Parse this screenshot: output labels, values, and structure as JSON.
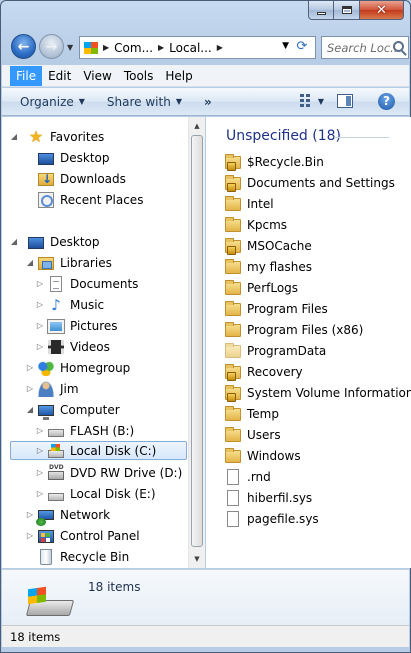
{
  "window": {
    "caption_buttons": [
      "minimize",
      "maximize",
      "close"
    ]
  },
  "nav": {
    "breadcrumbs": [
      "Com...",
      "Local..."
    ],
    "search_placeholder": "Search Loc..."
  },
  "menu": [
    "File",
    "Edit",
    "View",
    "Tools",
    "Help"
  ],
  "toolbar": {
    "organize": "Organize",
    "share_with": "Share with",
    "more": "»"
  },
  "tree": [
    {
      "label": "Favorites",
      "icon": "star-icon"
    },
    {
      "label": "Desktop",
      "icon": "desktop-icon"
    },
    {
      "label": "Downloads",
      "icon": "downloads-folder-icon"
    },
    {
      "label": "Recent Places",
      "icon": "recent-places-icon"
    },
    {
      "label": "Desktop",
      "icon": "desktop-icon"
    },
    {
      "label": "Libraries",
      "icon": "libraries-icon"
    },
    {
      "label": "Documents",
      "icon": "document-icon"
    },
    {
      "label": "Music",
      "icon": "music-icon"
    },
    {
      "label": "Pictures",
      "icon": "pictures-icon"
    },
    {
      "label": "Videos",
      "icon": "videos-icon"
    },
    {
      "label": "Homegroup",
      "icon": "homegroup-icon"
    },
    {
      "label": "Jim",
      "icon": "user-icon"
    },
    {
      "label": "Computer",
      "icon": "computer-icon"
    },
    {
      "label": "FLASH (B:)",
      "icon": "flash-drive-icon"
    },
    {
      "label": "Local Disk (C:)",
      "icon": "local-disk-icon"
    },
    {
      "label": "DVD RW Drive (D:)",
      "icon": "dvd-drive-icon"
    },
    {
      "label": "Local Disk (E:)",
      "icon": "hard-disk-icon"
    },
    {
      "label": "Network",
      "icon": "network-icon"
    },
    {
      "label": "Control Panel",
      "icon": "control-panel-icon"
    },
    {
      "label": "Recycle Bin",
      "icon": "recycle-bin-icon"
    }
  ],
  "content": {
    "group_header": "Unspecified (18)",
    "items": [
      {
        "name": "$Recycle.Bin",
        "icon": "locked-folder-icon"
      },
      {
        "name": "Documents and Settings",
        "icon": "locked-folder-icon"
      },
      {
        "name": "Intel",
        "icon": "folder-icon"
      },
      {
        "name": "Kpcms",
        "icon": "folder-icon"
      },
      {
        "name": "MSOCache",
        "icon": "locked-folder-icon"
      },
      {
        "name": "my flashes",
        "icon": "folder-icon"
      },
      {
        "name": "PerfLogs",
        "icon": "folder-icon"
      },
      {
        "name": "Program Files",
        "icon": "folder-icon"
      },
      {
        "name": "Program Files (x86)",
        "icon": "folder-icon"
      },
      {
        "name": "ProgramData",
        "icon": "folder-icon"
      },
      {
        "name": "Recovery",
        "icon": "locked-folder-icon"
      },
      {
        "name": "System Volume Information",
        "icon": "locked-folder-icon"
      },
      {
        "name": "Temp",
        "icon": "folder-icon"
      },
      {
        "name": "Users",
        "icon": "folder-icon"
      },
      {
        "name": "Windows",
        "icon": "folder-icon"
      },
      {
        "name": ".rnd",
        "icon": "file-icon"
      },
      {
        "name": "hiberfil.sys",
        "icon": "file-icon"
      },
      {
        "name": "pagefile.sys",
        "icon": "file-icon"
      }
    ]
  },
  "details": {
    "count": "18 items"
  },
  "status": {
    "text": "18 items"
  }
}
